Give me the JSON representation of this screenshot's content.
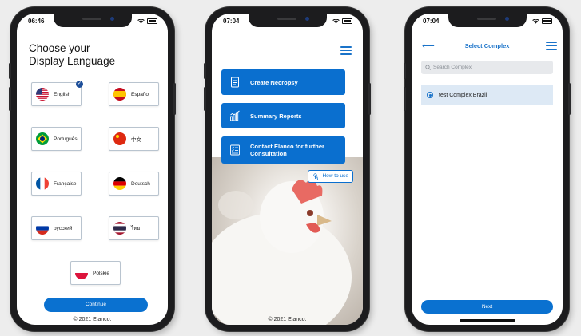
{
  "phone1": {
    "time": "06:46",
    "title": "Choose your\nDisplay Language",
    "languages": [
      {
        "label": "English",
        "flag": "flag-us-icon",
        "selected": true
      },
      {
        "label": "Español",
        "flag": "flag-es-icon",
        "selected": false
      },
      {
        "label": "Português",
        "flag": "flag-br-icon",
        "selected": false
      },
      {
        "label": "中文",
        "flag": "flag-cn-icon",
        "selected": false
      },
      {
        "label": "Française",
        "flag": "flag-fr-icon",
        "selected": false
      },
      {
        "label": "Deutsch",
        "flag": "flag-de-icon",
        "selected": false
      },
      {
        "label": "русский",
        "flag": "flag-ru-icon",
        "selected": false
      },
      {
        "label": "ไทย",
        "flag": "flag-th-icon",
        "selected": false
      },
      {
        "label": "Polskie",
        "flag": "flag-pl-icon",
        "selected": false
      }
    ],
    "continue_label": "Continue",
    "copyright": "© 2021 Elanco."
  },
  "phone2": {
    "time": "07:04",
    "menu": [
      {
        "label": "Create Necropsy",
        "icon": "document-icon"
      },
      {
        "label": "Summary Reports",
        "icon": "bar-chart-icon"
      },
      {
        "label": "Contact Elanco for further Consultation",
        "icon": "checklist-icon"
      }
    ],
    "howto_label": "How to use",
    "copyright": "© 2021 Elanco."
  },
  "phone3": {
    "time": "07:04",
    "title": "Select Complex",
    "search_placeholder": "Search Complex",
    "items": [
      {
        "label": "test Complex Brazil",
        "selected": true
      }
    ],
    "next_label": "Next"
  },
  "colors": {
    "primary": "#0a71d0",
    "accent_text": "#1a73c9",
    "selected_row": "#dde9f5",
    "background": "#ededed"
  }
}
